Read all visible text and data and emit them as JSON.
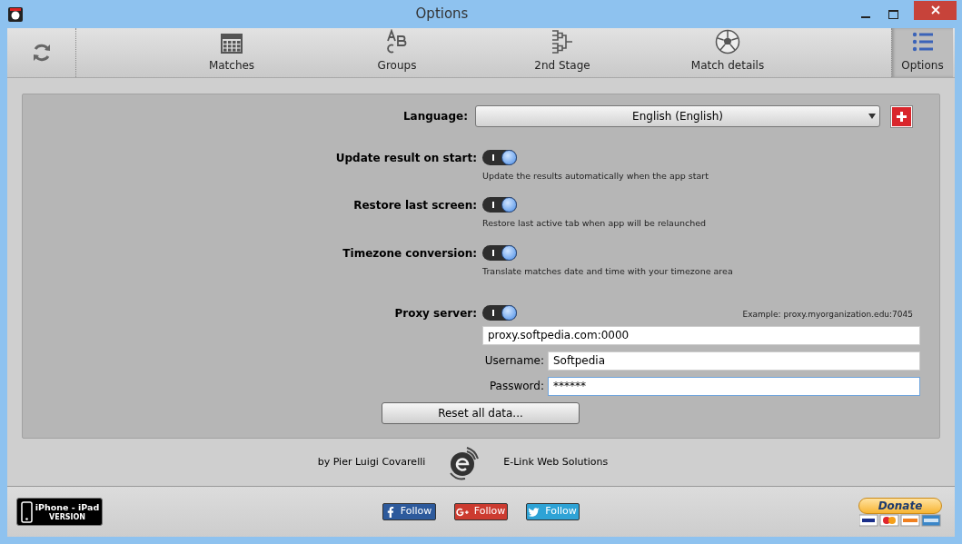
{
  "window": {
    "title": "Options"
  },
  "toolbar": {
    "items": [
      {
        "label": "Matches",
        "kind": "calendar",
        "selected": false
      },
      {
        "label": "Groups",
        "kind": "abc",
        "selected": false
      },
      {
        "label": "2nd Stage",
        "kind": "bracket",
        "selected": false
      },
      {
        "label": "Match details",
        "kind": "ball",
        "selected": false
      },
      {
        "label": "Options",
        "kind": "list",
        "selected": true
      }
    ]
  },
  "language": {
    "label": "Language:",
    "value": "English (English)"
  },
  "toggles": [
    {
      "label": "Update result on start:",
      "on": true,
      "description": "Update the results automatically when the app start"
    },
    {
      "label": "Restore last screen:",
      "on": true,
      "description": "Restore last active tab when app will be relaunched"
    },
    {
      "label": "Timezone conversion:",
      "on": true,
      "description": "Translate matches date and time with your timezone area"
    }
  ],
  "proxy": {
    "label": "Proxy server:",
    "on": true,
    "example": "Example: proxy.myorganization.edu:7045",
    "address": "proxy.softpedia.com:0000",
    "username_label": "Username:",
    "username": "Softpedia",
    "password_label": "Password:",
    "password": "******"
  },
  "reset_button": "Reset all data...",
  "credits": {
    "author": "by Pier Luigi Covarelli",
    "company": "E-Link Web Solutions"
  },
  "bottom_bar": {
    "badge_title": "iPhone - iPad",
    "badge_subtitle": "VERSION",
    "follow_buttons": [
      {
        "label": "Follow",
        "kind": "facebook",
        "color": "#2d5a9c"
      },
      {
        "label": "Follow",
        "kind": "google",
        "color": "#cc3b30"
      },
      {
        "label": "Follow",
        "kind": "twitter",
        "color": "#2ea3d6"
      }
    ],
    "donate": "Donate"
  }
}
